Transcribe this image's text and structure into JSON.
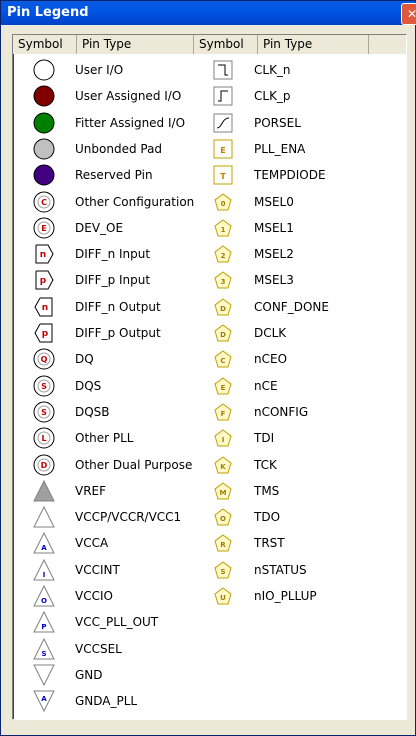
{
  "window": {
    "title": "Pin Legend",
    "close_label": "✕"
  },
  "headers": {
    "symbol_left": "Symbol",
    "type_left": "Pin Type",
    "symbol_right": "Symbol",
    "type_right": "Pin Type"
  },
  "left_items": [
    {
      "label": "User I/O",
      "icon": "circle-open"
    },
    {
      "label": "User Assigned I/O",
      "icon": "circle-filled",
      "color": "#800000"
    },
    {
      "label": "Fitter Assigned I/O",
      "icon": "circle-filled",
      "color": "#008000"
    },
    {
      "label": "Unbonded Pad",
      "icon": "circle-filled",
      "color": "#c0c0c0"
    },
    {
      "label": "Reserved Pin",
      "icon": "circle-filled",
      "color": "#400080"
    },
    {
      "label": "Other Configuration",
      "icon": "circle-letter",
      "letter": "C"
    },
    {
      "label": "DEV_OE",
      "icon": "circle-letter",
      "letter": "E"
    },
    {
      "label": "DIFF_n Input",
      "icon": "diff-input",
      "letter": "n"
    },
    {
      "label": "DIFF_p Input",
      "icon": "diff-input",
      "letter": "p"
    },
    {
      "label": "DIFF_n Output",
      "icon": "diff-output",
      "letter": "n"
    },
    {
      "label": "DIFF_p Output",
      "icon": "diff-output",
      "letter": "p"
    },
    {
      "label": "DQ",
      "icon": "circle-letter",
      "letter": "Q"
    },
    {
      "label": "DQS",
      "icon": "circle-letter",
      "letter": "S"
    },
    {
      "label": "DQSB",
      "icon": "circle-letter",
      "letter": "S"
    },
    {
      "label": "Other PLL",
      "icon": "circle-letter",
      "letter": "L"
    },
    {
      "label": "Other Dual Purpose",
      "icon": "circle-letter",
      "letter": "D"
    },
    {
      "label": "VREF",
      "icon": "triangle-filled"
    },
    {
      "label": "VCCP/VCCR/VCC1",
      "icon": "triangle-open"
    },
    {
      "label": "VCCA",
      "icon": "triangle-letter",
      "letter": "A"
    },
    {
      "label": "VCCINT",
      "icon": "triangle-letter",
      "letter": "I"
    },
    {
      "label": "VCCIO",
      "icon": "triangle-letter",
      "letter": "O"
    },
    {
      "label": "VCC_PLL_OUT",
      "icon": "triangle-letter",
      "letter": "P"
    },
    {
      "label": "VCCSEL",
      "icon": "triangle-letter",
      "letter": "S"
    },
    {
      "label": "GND",
      "icon": "triangle-down"
    },
    {
      "label": "GNDA_PLL",
      "icon": "triangle-down-letter",
      "letter": "A"
    }
  ],
  "right_items": [
    {
      "label": "CLK_n",
      "icon": "clk-n"
    },
    {
      "label": "CLK_p",
      "icon": "clk-p"
    },
    {
      "label": "PORSEL",
      "icon": "porsel"
    },
    {
      "label": "PLL_ENA",
      "icon": "square-letter",
      "letter": "E"
    },
    {
      "label": "TEMPDIODE",
      "icon": "square-letter",
      "letter": "T"
    },
    {
      "label": "MSEL0",
      "icon": "pentagon",
      "letter": "0"
    },
    {
      "label": "MSEL1",
      "icon": "pentagon",
      "letter": "1"
    },
    {
      "label": "MSEL2",
      "icon": "pentagon",
      "letter": "2"
    },
    {
      "label": "MSEL3",
      "icon": "pentagon",
      "letter": "3"
    },
    {
      "label": "CONF_DONE",
      "icon": "pentagon",
      "letter": "D"
    },
    {
      "label": "DCLK",
      "icon": "pentagon",
      "letter": "D"
    },
    {
      "label": "nCEO",
      "icon": "pentagon",
      "letter": "C"
    },
    {
      "label": "nCE",
      "icon": "pentagon",
      "letter": "E"
    },
    {
      "label": "nCONFIG",
      "icon": "pentagon",
      "letter": "F"
    },
    {
      "label": "TDI",
      "icon": "pentagon",
      "letter": "I"
    },
    {
      "label": "TCK",
      "icon": "pentagon",
      "letter": "K"
    },
    {
      "label": "TMS",
      "icon": "pentagon",
      "letter": "M"
    },
    {
      "label": "TDO",
      "icon": "pentagon",
      "letter": "O"
    },
    {
      "label": "TRST",
      "icon": "pentagon",
      "letter": "R"
    },
    {
      "label": "nSTATUS",
      "icon": "pentagon",
      "letter": "S"
    },
    {
      "label": "nIO_PLLUP",
      "icon": "pentagon",
      "letter": "U"
    }
  ],
  "colors": {
    "title_bar": "#0055e5",
    "icon_stroke": "#000000",
    "pentagon_fill": "#fff8c8",
    "pentagon_stroke": "#c0a000",
    "square_stroke": "#c0a000",
    "triangle_fill": "#a0a0a0",
    "triangle_letter": "#0000c0",
    "circle_letter": "#c00000"
  }
}
